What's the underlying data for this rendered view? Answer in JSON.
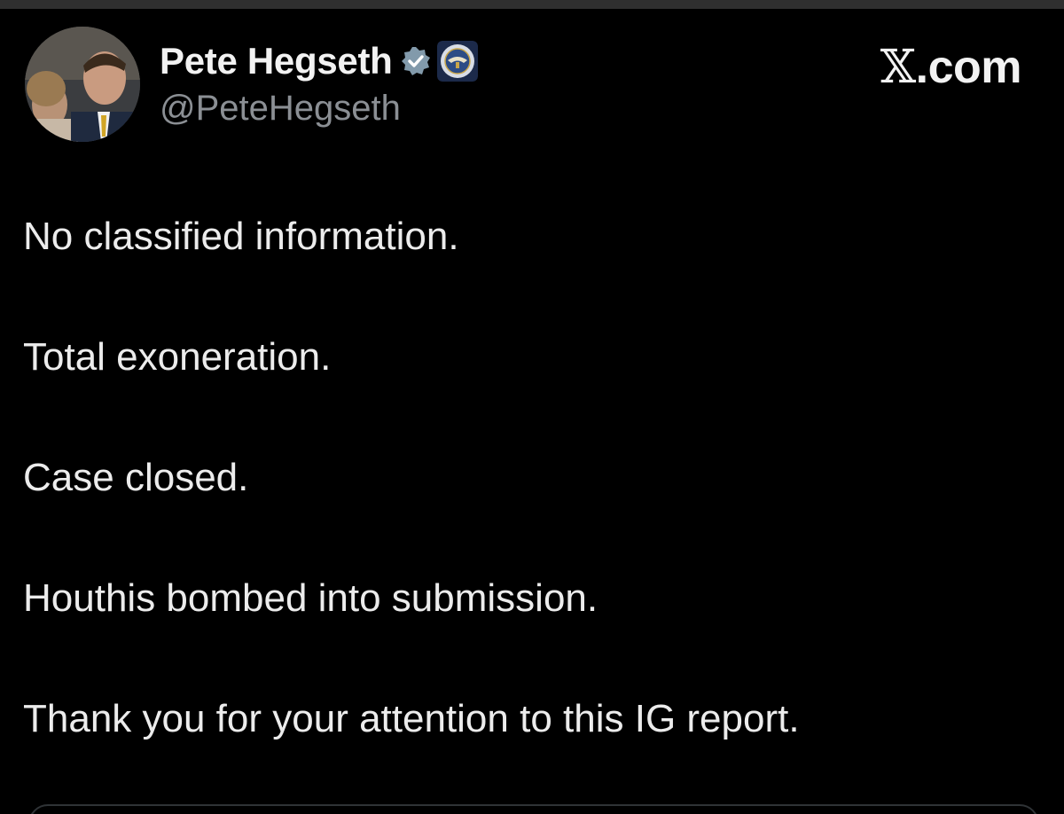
{
  "tweet": {
    "display_name": "Pete Hegseth",
    "handle": "@PeteHegseth",
    "brand": "X.com",
    "lines": [
      "No classified information.",
      "Total exoneration.",
      "Case closed.",
      "Houthis bombed into submission.",
      "Thank you for your attention to this IG report."
    ]
  },
  "icons": {
    "verified": "verified-badge-icon",
    "affiliation": "department-seal-icon",
    "avatar": "profile-photo"
  },
  "colors": {
    "background": "#000000",
    "text": "#e7e9ea",
    "muted": "#8b8f94",
    "verified_badge": "#829aab",
    "affiliation_badge": "#1c2a4a"
  }
}
